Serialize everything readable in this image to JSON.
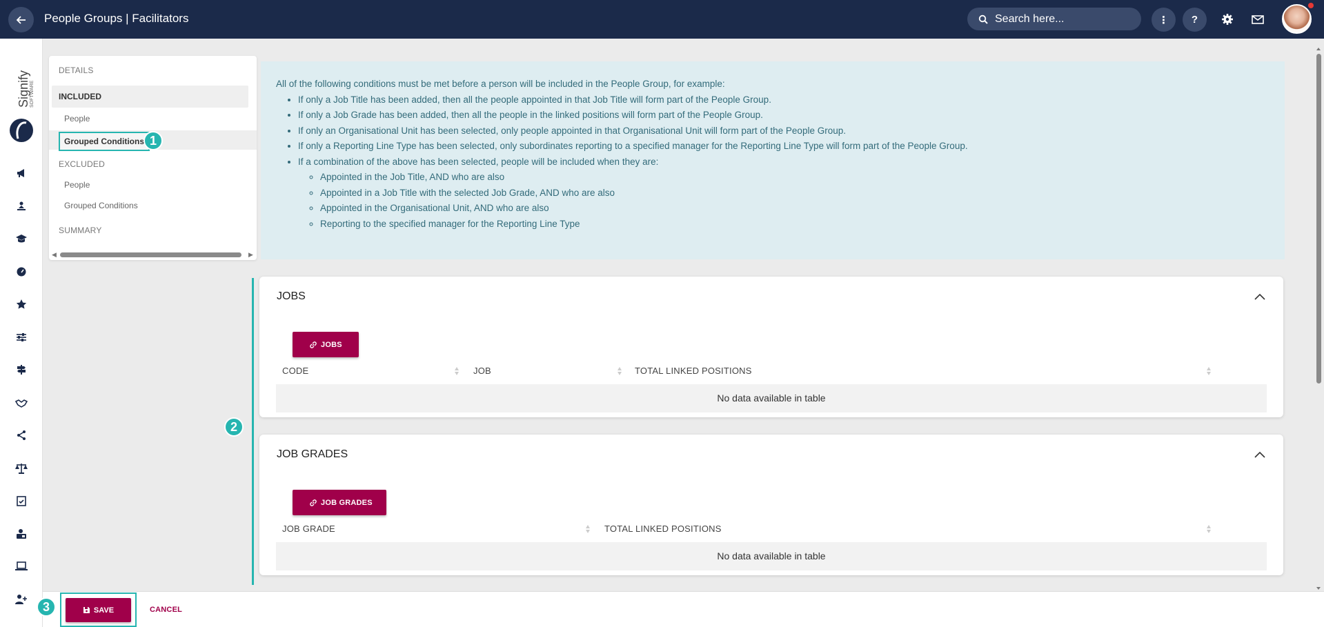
{
  "header": {
    "title": "People Groups | Facilitators",
    "search_placeholder": "Search here...",
    "more_label": "⋮",
    "help_label": "?"
  },
  "logo": {
    "brand": "Signify",
    "sub": "SOFTWARE"
  },
  "rail_icons": [
    "megaphone-icon",
    "person-desk-icon",
    "graduation-cap-icon",
    "dashboard-gauge-icon",
    "star-icon",
    "sliders-icon",
    "signpost-icon",
    "handshake-icon",
    "org-chart-icon",
    "scales-icon",
    "calendar-check-icon",
    "user-lock-icon",
    "laptop-icon",
    "user-add-icon"
  ],
  "nav": {
    "details": "DETAILS",
    "included": "INCLUDED",
    "included_people": "People",
    "included_grouped": "Grouped Conditions",
    "excluded": "EXCLUDED",
    "excluded_people": "People",
    "excluded_grouped": "Grouped Conditions",
    "summary": "SUMMARY"
  },
  "badges": {
    "one": "1",
    "two": "2",
    "three": "3"
  },
  "info": {
    "intro": "All of the following conditions must be met before a person will be included in the People Group, for example:",
    "bullets": [
      "If only a Job Title has been added, then all the people appointed in that Job Title will form part of the People Group.",
      "If only a Job Grade has been added, then all the people in the linked positions will form part of the People Group.",
      "If only an Organisational Unit has been selected, only people appointed in that Organisational Unit will form part of the People Group.",
      "If only a Reporting Line Type has been selected, only subordinates reporting to a specified manager for the Reporting Line Type will form part of the People Group.",
      "If a combination of the above has been selected, people will be included when they are:"
    ],
    "sub_bullets": [
      "Appointed in the Job Title, AND who are also",
      "Appointed in a Job Title with the selected Job Grade, AND who are also",
      "Appointed in the Organisational Unit, AND who are also",
      "Reporting to the specified manager for the Reporting Line Type"
    ]
  },
  "jobs_card": {
    "title": "JOBS",
    "button": "JOBS",
    "columns": [
      "CODE",
      "JOB",
      "TOTAL LINKED POSITIONS"
    ],
    "empty": "No data available in table"
  },
  "grades_card": {
    "title": "JOB GRADES",
    "button": "JOB GRADES",
    "columns": [
      "JOB GRADE",
      "TOTAL LINKED POSITIONS"
    ],
    "empty": "No data available in table"
  },
  "footer": {
    "save": "SAVE",
    "cancel": "CANCEL"
  },
  "colors": {
    "header_bg": "#1b2a4a",
    "accent": "#a0004a",
    "teal": "#26b5b0",
    "info_bg": "#deedf1"
  }
}
